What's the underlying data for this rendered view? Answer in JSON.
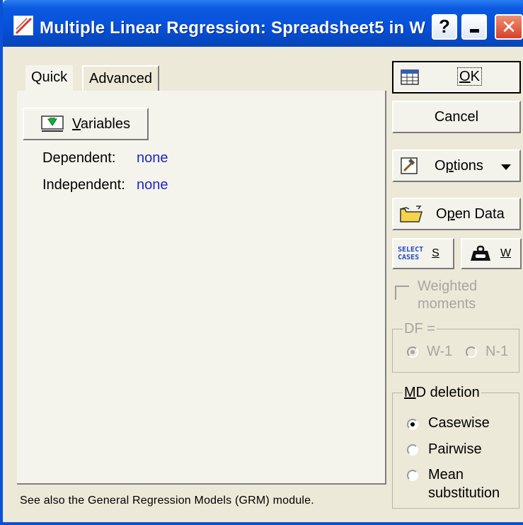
{
  "window": {
    "title": "Multiple Linear Regression: Spreadsheet5 in W",
    "help_label": "?",
    "close_label": "✕"
  },
  "tabs": [
    {
      "label": "Quick",
      "active": true
    },
    {
      "label": "Advanced",
      "active": false
    }
  ],
  "quick": {
    "variables_button": {
      "hotkey": "V",
      "rest": "ariables"
    },
    "dependent_label": "Dependent:",
    "dependent_value": "none",
    "independent_label": "Independent:",
    "independent_value": "none"
  },
  "footer_note": "See also the General Regression Models (GRM) module.",
  "buttons": {
    "ok": {
      "hotkey": "O",
      "rest": "K"
    },
    "cancel": "Cancel",
    "options": {
      "hotkey": "p",
      "before": "O",
      "rest": "tions"
    },
    "open_data": {
      "before": "O",
      "hotkey": "p",
      "rest": "en Data"
    },
    "select_cases": {
      "line1": "SELECT",
      "line2": "CASES",
      "hotkey": "S"
    },
    "weight": {
      "hotkey": "W"
    }
  },
  "weighted_moments": {
    "label": "Weighted moments",
    "checked": false,
    "enabled": false
  },
  "df_group": {
    "title": "DF =",
    "options": [
      {
        "label": "W-1",
        "checked": true
      },
      {
        "label": "N-1",
        "checked": false
      }
    ]
  },
  "md_deletion": {
    "title_hotkey": "M",
    "title_rest": "D deletion",
    "options": [
      {
        "label": "Casewise",
        "checked": true
      },
      {
        "label": "Pairwise",
        "checked": false
      },
      {
        "label": "Mean",
        "label2": "substitution",
        "checked": false
      }
    ]
  },
  "colors": {
    "titlebar": "#0650d9",
    "dialog_bg": "#ece9d8",
    "value_link": "#1d24c9",
    "disabled_text": "#a7a69f"
  }
}
